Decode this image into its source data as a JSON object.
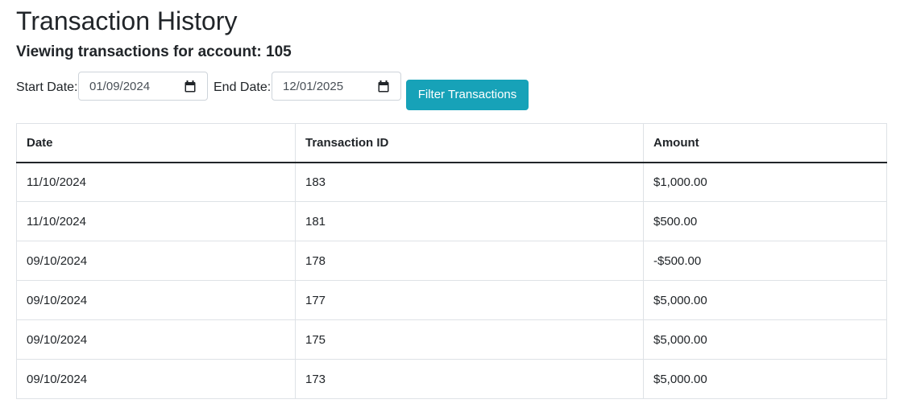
{
  "page": {
    "title": "Transaction History",
    "subtitle": "Viewing transactions for account: 105"
  },
  "filters": {
    "start_label": "Start Date:",
    "start_value": "01/09/2024",
    "end_label": "End Date:",
    "end_value": "12/01/2025",
    "button_label": "Filter Transactions",
    "calendar_icon": "calendar-icon"
  },
  "colors": {
    "accent": "#17a2b8",
    "text": "#212529",
    "border": "#dee2e6"
  },
  "table": {
    "headers": [
      "Date",
      "Transaction ID",
      "Amount"
    ],
    "rows": [
      [
        "11/10/2024",
        "183",
        "$1,000.00"
      ],
      [
        "11/10/2024",
        "181",
        "$500.00"
      ],
      [
        "09/10/2024",
        "178",
        "-$500.00"
      ],
      [
        "09/10/2024",
        "177",
        "$5,000.00"
      ],
      [
        "09/10/2024",
        "175",
        "$5,000.00"
      ],
      [
        "09/10/2024",
        "173",
        "$5,000.00"
      ]
    ]
  }
}
